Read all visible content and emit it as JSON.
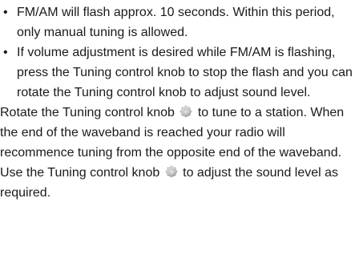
{
  "bullets": [
    {
      "marker": "•",
      "text": "FM/AM will flash approx. 10 seconds. Within this period, only manual tuning is allowed."
    },
    {
      "marker": "•",
      "text": "If volume adjustment is desired while FM/AM is flashing, press the Tuning control knob to stop the flash and you can rotate the Tuning control knob to adjust sound level."
    }
  ],
  "paragraphs": [
    {
      "before_icon": "Rotate the Tuning control knob",
      "after_icon": "to tune to a station. When the end of the waveband is reached your radio will recommence tuning from the opposite end of the waveband.",
      "icon": "tuning-knob-icon"
    },
    {
      "before_icon": "Use the Tuning control knob",
      "after_icon": "to adjust the sound level as required.",
      "icon": "tuning-knob-icon"
    }
  ],
  "colors": {
    "text": "#1a1a1a",
    "knob_light": "#e6e6e6",
    "knob_dark": "#9a9a9a"
  }
}
